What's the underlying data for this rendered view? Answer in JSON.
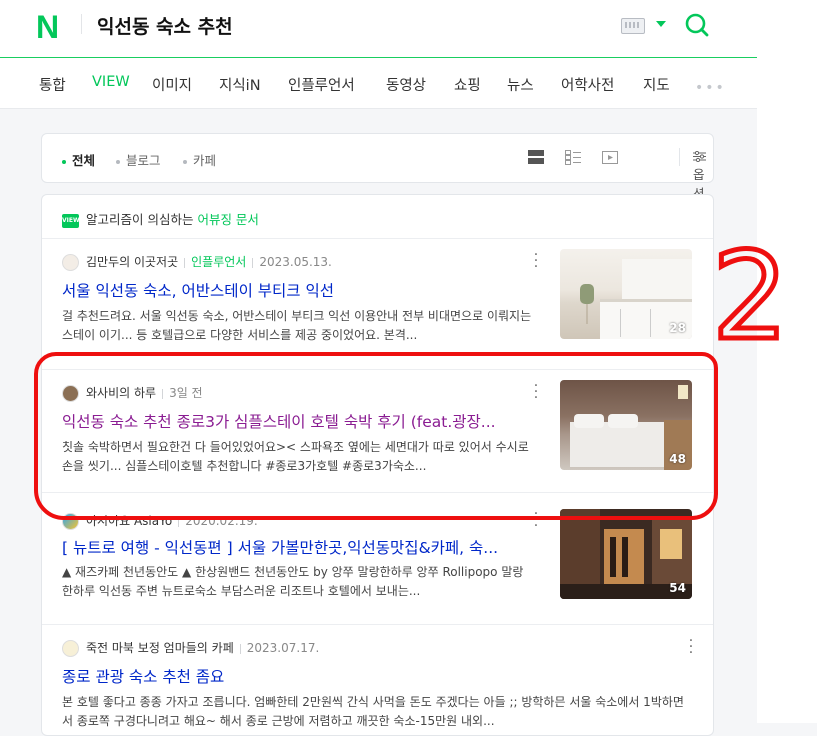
{
  "header": {
    "logo": "N",
    "query": "익선동 숙소 추천",
    "icons": {
      "keyboard": "keyboard-icon",
      "dropdown": "caret-down-icon",
      "search": "search-icon"
    },
    "accent": "#03c75a"
  },
  "tabs": [
    {
      "label": "통합"
    },
    {
      "label": "VIEW",
      "active": true
    },
    {
      "label": "이미지"
    },
    {
      "label": "지식iN"
    },
    {
      "label": "인플루언서"
    },
    {
      "label": "동영상"
    },
    {
      "label": "쇼핑"
    },
    {
      "label": "뉴스"
    },
    {
      "label": "어학사전"
    },
    {
      "label": "지도"
    }
  ],
  "filters": {
    "items": [
      {
        "label": "전체",
        "active": true
      },
      {
        "label": "블로그"
      },
      {
        "label": "카페"
      }
    ],
    "options_label": "옵션"
  },
  "notice": {
    "badge": "VIEW",
    "text": "알고리즘이 의심하는 ",
    "link": "어뷰징 문서"
  },
  "results": [
    {
      "author": "김만두의 이곳저곳",
      "influencer": "인플루언서",
      "date": "2023.05.13.",
      "title": "서울 익선동 숙소, 어반스테이 부티크 익선",
      "desc": "걸 추천드려요. 서울 익선동 숙소, 어반스테이 부티크 익선 이용안내 전부 비대면으로 이뤄지는 스테이 이기... 등 호텔급으로 다양한 서비스를 제공 중이었어요. 본격...",
      "count": "28"
    },
    {
      "author": "와사비의 하루",
      "date": "3일 전",
      "title": "익선동 숙소 추천 종로3가 심플스테이 호텔 숙박 후기 (feat.광장...",
      "desc": "칫솔 숙박하면서 필요한건 다 들어있었어요>< 스파욕조 옆에는 세면대가 따로 있어서 수시로 손을 씻기... 심플스테이호텔 추천합니다 #종로3가호텔 #종로3가숙소...",
      "count": "48"
    },
    {
      "author": "아시아요 AsiaYo",
      "date": "2020.02.19.",
      "title": "[ 뉴트로 여행 - 익선동편 ] 서울 가볼만한곳,익선동맛집&카페, 숙...",
      "desc": "▲ 재즈카페 천년동안도 ▲ 한상원밴드 천년동안도 by 앙쭈 말랑한하루 앙쭈 Rollipopo 말랑한하루 익선동 주변 뉴트로숙소 부담스러운 리조트나 호텔에서 보내는...",
      "count": "54"
    },
    {
      "author": "죽전 마북 보정 엄마들의 카페",
      "date": "2023.07.17.",
      "title": "종로 관광 숙소 추천 좀요",
      "desc": "본 호텔 좋다고 종종 가자고 조릅니다. 엄빠한테 2만원씩 간식 사먹을 돈도 주겠다는 아들 ;; 방학하믄 서울 숙소에서 1박하면서 종로쪽 구경다니려고 해요~ 해서 종로 근방에 저렴하고 깨끗한 숙소-15만원 내외..."
    }
  ],
  "annotation": {
    "text": "2",
    "color": "#ee0f0f"
  }
}
